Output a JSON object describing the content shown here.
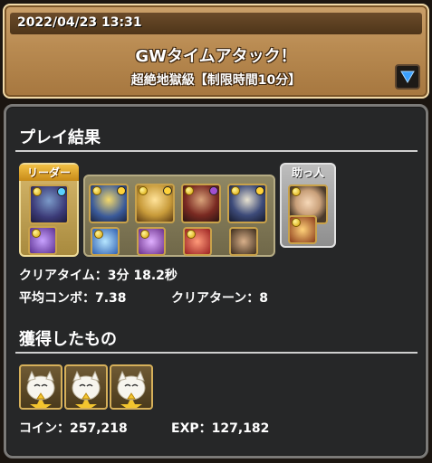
{
  "header": {
    "datetime": "2022/04/23 13:31",
    "title": "GWタイムアタック！",
    "subtitle": "超絶地獄級【制限時間10分】"
  },
  "result": {
    "section_title": "プレイ結果",
    "leader_label": "リーダー",
    "helper_label": "助っ人",
    "team": {
      "leader": {
        "icon": "monster-portrait-icon",
        "assist_icon": "assist-equip-icon"
      },
      "subs": [
        {
          "icon": "monster-portrait-icon",
          "assist_icon": "assist-equip-icon"
        },
        {
          "icon": "monster-portrait-icon",
          "assist_icon": "assist-equip-icon"
        },
        {
          "icon": "monster-portrait-icon",
          "assist_icon": "assist-equip-icon"
        },
        {
          "icon": "monster-portrait-icon",
          "assist_icon": "assist-equip-icon"
        }
      ],
      "helper": {
        "icon": "monster-portrait-icon",
        "assist_icon": "assist-equip-icon"
      }
    },
    "clear_time": "クリアタイム：3分 18.2秒",
    "avg_combo": "平均コンボ：7.38",
    "clear_turns": "クリアターン：8"
  },
  "rewards": {
    "section_title": "獲得したもの",
    "items": [
      {
        "icon": "tamazo-cat-icon"
      },
      {
        "icon": "tamazo-cat-icon"
      },
      {
        "icon": "tamazo-cat-icon"
      }
    ],
    "coin": "コイン：257,218",
    "exp": "EXP：127,182"
  },
  "colors": {
    "header_gold": "#b98b52",
    "panel_bg": "#262728",
    "leader_gold": "#d7b86c",
    "helper_silver": "#bdbdbd"
  }
}
